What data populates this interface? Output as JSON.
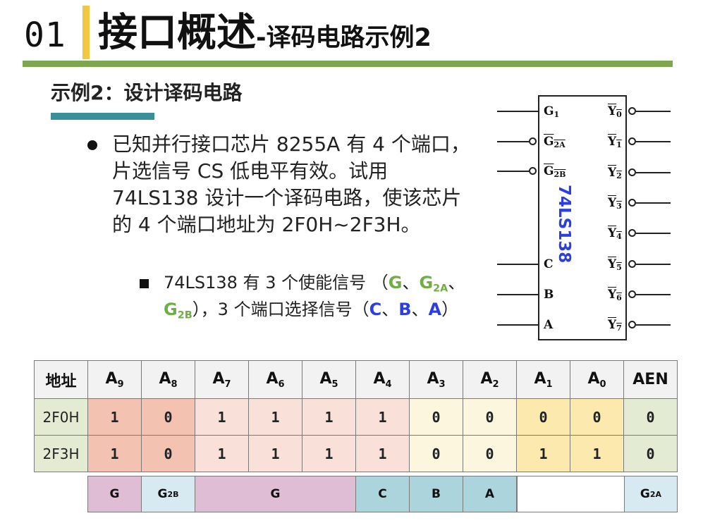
{
  "header": {
    "number": "01",
    "title_main": "接口概述",
    "title_sub": "-译码电路示例2"
  },
  "subtitle": "示例2：设计译码电路",
  "bullet": {
    "text": "已知并行接口芯片 8255A 有 4 个端口，片选信号 CS 低电平有效。试用 74LS138 设计一个译码电路，使该芯片的 4 个端口地址为 2F0H~2F3H。"
  },
  "subbullet": {
    "p1": "74LS138 有 3 个使能信号 （",
    "g": "G",
    "sep1": "、",
    "g2a_base": "G",
    "g2a_sub": "2A",
    "sep2": "、",
    "g2b_base": "G",
    "g2b_sub": "2B",
    "p2": "），3 个端口选择信号（",
    "c": "C",
    "sep3": "、",
    "bsig": "B",
    "sep4": "、",
    "a": "A",
    "p3": "）"
  },
  "chip": {
    "name": "74LS138",
    "left_pins": [
      {
        "base": "G",
        "sub": "1",
        "inverted": false
      },
      {
        "base": "G",
        "sub": "2A",
        "inverted": true
      },
      {
        "base": "G",
        "sub": "2B",
        "inverted": true
      },
      {
        "base": "C",
        "sub": "",
        "inverted": false
      },
      {
        "base": "B",
        "sub": "",
        "inverted": false
      },
      {
        "base": "A",
        "sub": "",
        "inverted": false
      }
    ],
    "right_pins": [
      {
        "base": "Y",
        "sub": "0"
      },
      {
        "base": "Y",
        "sub": "1"
      },
      {
        "base": "Y",
        "sub": "2"
      },
      {
        "base": "Y",
        "sub": "3"
      },
      {
        "base": "Y",
        "sub": "4"
      },
      {
        "base": "Y",
        "sub": "5"
      },
      {
        "base": "Y",
        "sub": "6"
      },
      {
        "base": "Y",
        "sub": "7"
      }
    ]
  },
  "table": {
    "headers": [
      {
        "base": "地址",
        "sub": ""
      },
      {
        "base": "A",
        "sub": "9"
      },
      {
        "base": "A",
        "sub": "8"
      },
      {
        "base": "A",
        "sub": "7"
      },
      {
        "base": "A",
        "sub": "6"
      },
      {
        "base": "A",
        "sub": "5"
      },
      {
        "base": "A",
        "sub": "4"
      },
      {
        "base": "A",
        "sub": "3"
      },
      {
        "base": "A",
        "sub": "2"
      },
      {
        "base": "A",
        "sub": "1"
      },
      {
        "base": "A",
        "sub": "0"
      },
      {
        "base": "AEN",
        "sub": ""
      }
    ],
    "rows": [
      {
        "label": "2F0H",
        "bits": [
          "1",
          "0",
          "1",
          "1",
          "1",
          "1",
          "0",
          "0",
          "0",
          "0",
          "0"
        ]
      },
      {
        "label": "2F3H",
        "bits": [
          "1",
          "0",
          "1",
          "1",
          "1",
          "1",
          "0",
          "0",
          "1",
          "1",
          "0"
        ]
      }
    ],
    "colors": [
      "#f3c2b0",
      "#f3c2b0",
      "#f9e0d8",
      "#f9e0d8",
      "#f9e0d8",
      "#f9e0d8",
      "#fdf6df",
      "#fdf6df",
      "#fbe9ad",
      "#fbe9ad",
      "#e3ecd3"
    ]
  },
  "signals": [
    {
      "base": "G",
      "sub": "",
      "color": "#dfbdd5"
    },
    {
      "base": "G",
      "sub": "2B",
      "color": "#d7eaf1"
    },
    {
      "base": "G",
      "sub": "",
      "color": "#dfbdd5"
    },
    {
      "base": "C",
      "sub": "",
      "color": "#acd4dc"
    },
    {
      "base": "B",
      "sub": "",
      "color": "#acd4dc"
    },
    {
      "base": "A",
      "sub": "",
      "color": "#acd4dc"
    },
    {
      "base": "G",
      "sub": "2A",
      "color": "#d7eaf1"
    }
  ],
  "colors": {
    "accent_bar": "#f2c744",
    "header_rule": "#7ea64f",
    "sub_rule": "#3a9099",
    "highlight_green": "#70ad47",
    "highlight_blue": "#2b3fe0"
  }
}
